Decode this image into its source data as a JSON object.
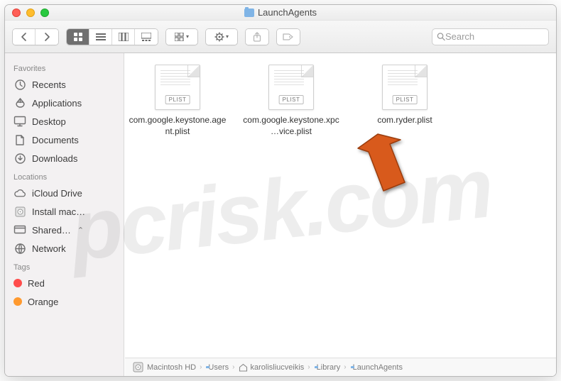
{
  "window": {
    "title": "LaunchAgents"
  },
  "toolbar": {
    "search_placeholder": "Search"
  },
  "sidebar": {
    "sections": [
      {
        "title": "Favorites",
        "items": [
          {
            "label": "Recents",
            "icon": "clock"
          },
          {
            "label": "Applications",
            "icon": "apps"
          },
          {
            "label": "Desktop",
            "icon": "desktop"
          },
          {
            "label": "Documents",
            "icon": "documents"
          },
          {
            "label": "Downloads",
            "icon": "downloads"
          }
        ]
      },
      {
        "title": "Locations",
        "items": [
          {
            "label": "iCloud Drive",
            "icon": "icloud"
          },
          {
            "label": "Install mac…",
            "icon": "disk"
          },
          {
            "label": "Shared…",
            "icon": "shared",
            "expand": true
          },
          {
            "label": "Network",
            "icon": "network"
          }
        ]
      },
      {
        "title": "Tags",
        "items": [
          {
            "label": "Red",
            "color": "#ff4d4c"
          },
          {
            "label": "Orange",
            "color": "#ff9a2f"
          }
        ]
      }
    ]
  },
  "files": [
    {
      "label": "com.google.keystone.agent.plist",
      "badge": "PLIST"
    },
    {
      "label": "com.google.keystone.xpc…vice.plist",
      "badge": "PLIST"
    },
    {
      "label": "com.ryder.plist",
      "badge": "PLIST"
    }
  ],
  "pathbar": [
    {
      "label": "Macintosh HD",
      "icon": "disk"
    },
    {
      "label": "Users",
      "icon": "folder"
    },
    {
      "label": "karolisliucveikis",
      "icon": "home"
    },
    {
      "label": "Library",
      "icon": "folder"
    },
    {
      "label": "LaunchAgents",
      "icon": "folder"
    }
  ],
  "watermark": "pcrisk.com",
  "annotation": {
    "arrow_color": "#d85a1e"
  }
}
